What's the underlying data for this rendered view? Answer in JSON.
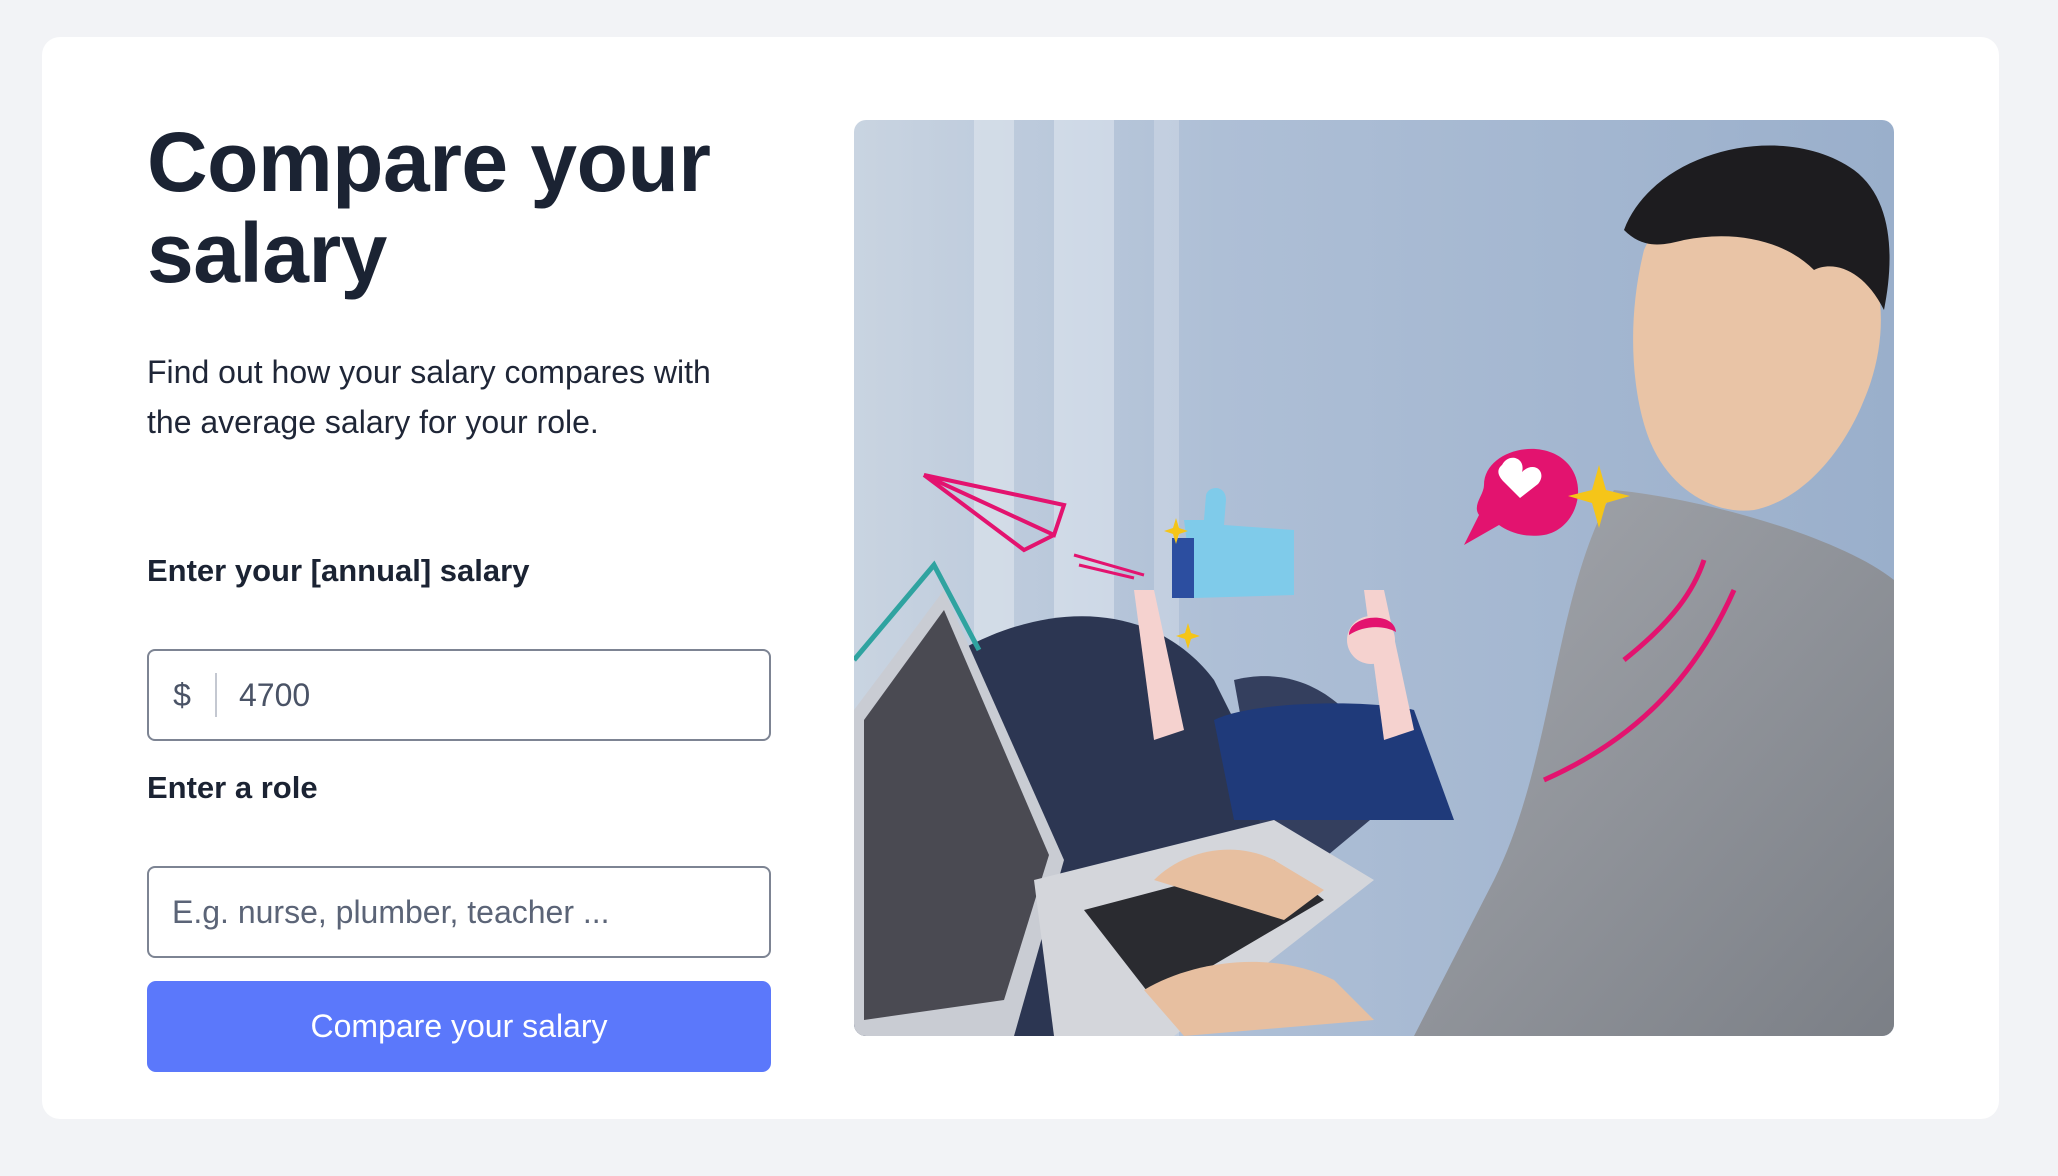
{
  "heading": {
    "title": "Compare your salary"
  },
  "intro": {
    "description": "Find out how your salary compares with the average salary for your role."
  },
  "salary": {
    "label": "Enter your [annual] salary",
    "currency_symbol": "$",
    "value": "4700"
  },
  "role": {
    "label": "Enter a role",
    "placeholder": "E.g. nurse, plumber, teacher ..."
  },
  "submit": {
    "label": "Compare your salary"
  },
  "hero_image": {
    "icon": "person-laptop-illustration-icon"
  },
  "colors": {
    "page_bg": "#f2f3f6",
    "card_bg": "#ffffff",
    "text": "#1b2333",
    "button": "#5b78fb",
    "button_text": "#ffffff",
    "input_border": "#7d8493",
    "accent_pink": "#e3136f",
    "accent_navy": "#1f3a7a",
    "accent_yellow": "#f5c518"
  }
}
